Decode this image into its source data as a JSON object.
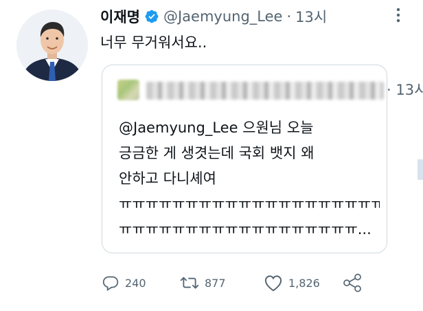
{
  "tweet": {
    "author_name": "이재명",
    "author_handle": "@Jaemyung_Lee",
    "separator": "·",
    "time": "13시",
    "text": "너무 무거워서요..",
    "verified_icon": "verified-badge-icon",
    "more_icon": "more-vertical-icon"
  },
  "quote": {
    "time": "· 13시",
    "lines": [
      "@Jaemyung_Lee 으원님 오늘",
      "긍금한 게 생겻는데 국회 뱃지 왜",
      "안하고 다니셰여",
      "ㅠㅠㅠㅠㅠㅠㅠㅠㅠㅠㅠㅠㅠㅠㅠㅠㅠㅠㅠㅠ",
      "ㅠㅠㅠㅠㅠㅠㅠㅠㅠㅠㅠㅠㅠㅠㅠㅠㅠㅠ..."
    ]
  },
  "actions": {
    "reply_count": "240",
    "retweet_count": "877",
    "like_count": "1,826"
  },
  "colors": {
    "primary_text": "#0f1419",
    "secondary_text": "#536471",
    "verified_blue": "#1d9bf0",
    "card_border": "#cfd9de"
  }
}
